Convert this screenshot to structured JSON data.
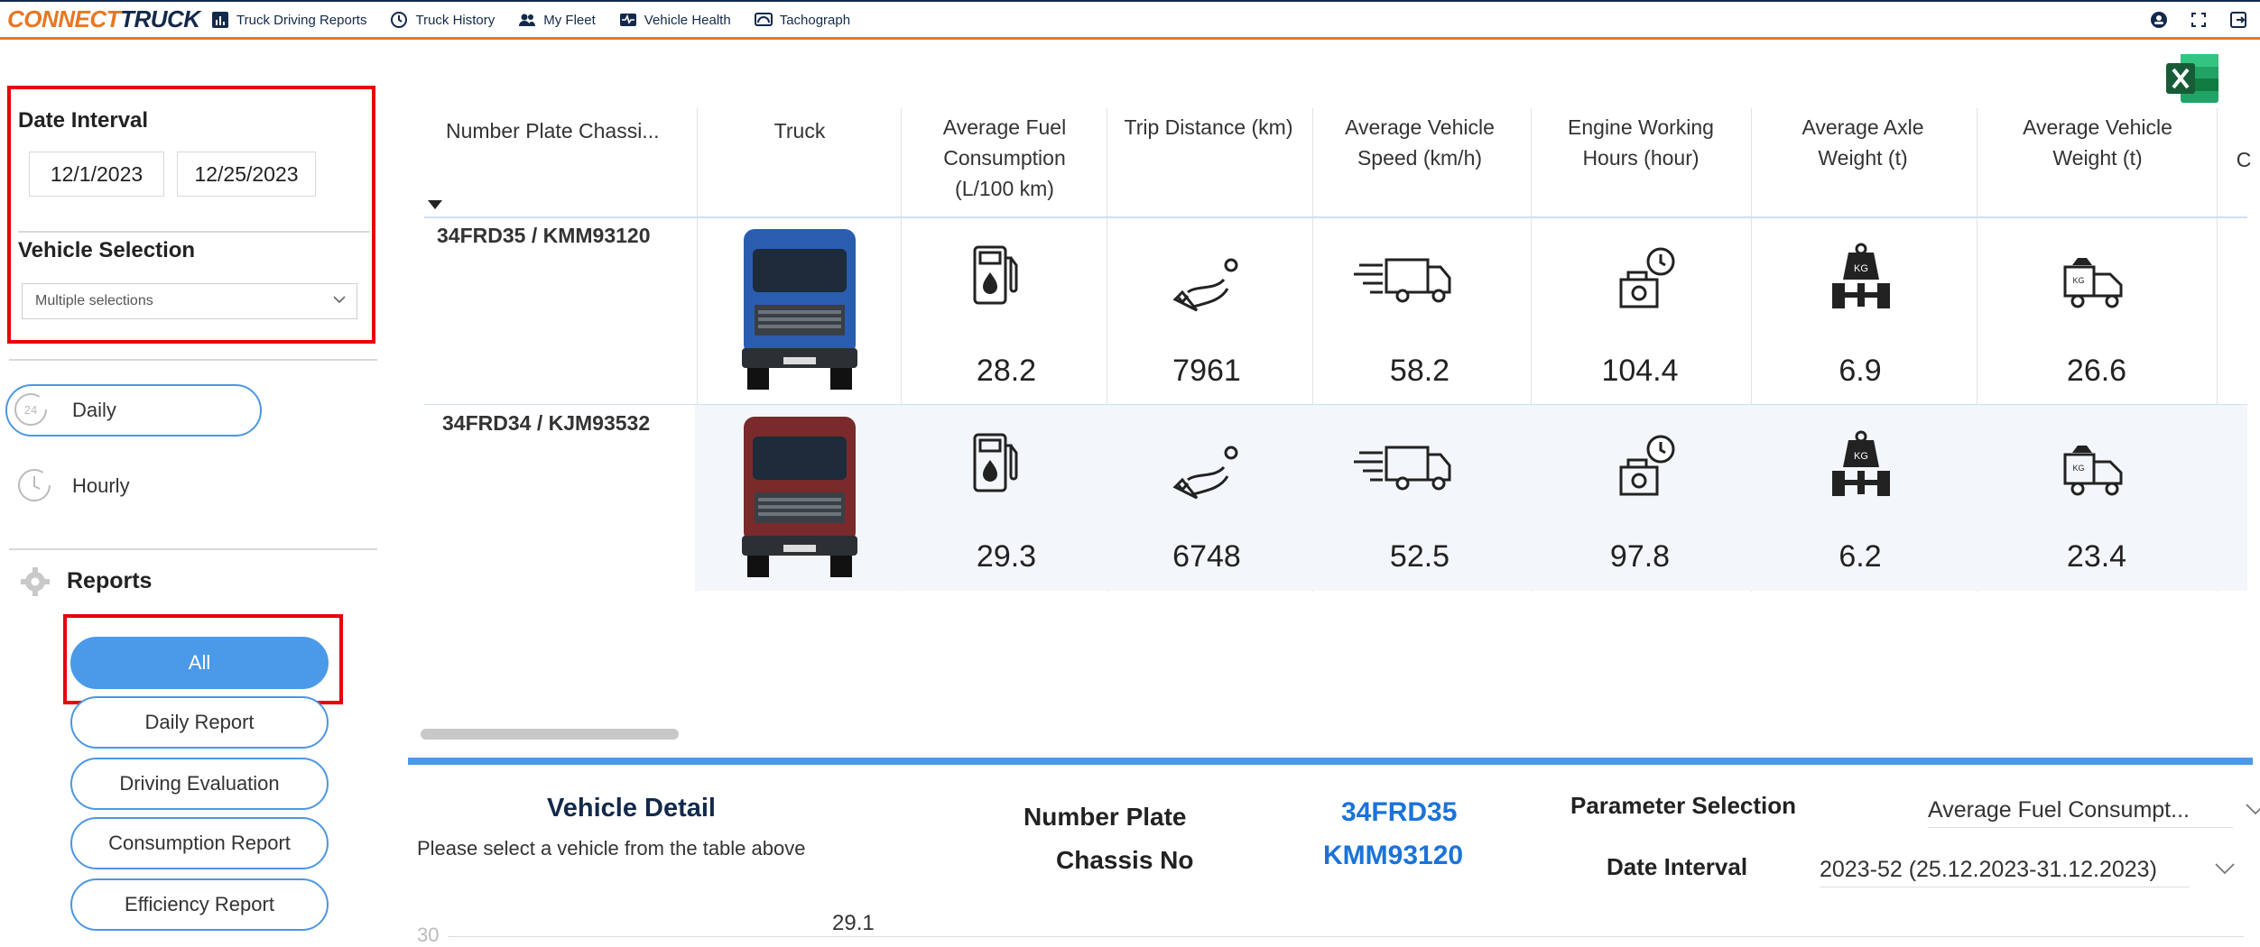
{
  "app": {
    "logo_part1": "CONNECT",
    "logo_part2": "RUCK",
    "nav": [
      {
        "label": "Truck Driving Reports",
        "icon": "report-icon"
      },
      {
        "label": "Truck History",
        "icon": "history-icon"
      },
      {
        "label": "My Fleet",
        "icon": "fleet-icon"
      },
      {
        "label": "Vehicle Health",
        "icon": "health-icon"
      },
      {
        "label": "Tachograph",
        "icon": "tachograph-icon"
      }
    ],
    "accent": "#e87722",
    "brand": "#13294b"
  },
  "sidebar": {
    "date_interval_label": "Date Interval",
    "start_date": "12/1/2023",
    "end_date": "12/25/2023",
    "vehicle_selection_label": "Vehicle Selection",
    "vehicle_selection_value": "Multiple selections",
    "frequency": [
      {
        "label": "Daily",
        "icon_text": "24"
      },
      {
        "label": "Hourly"
      }
    ],
    "reports_label": "Reports",
    "reports": [
      {
        "label": "All",
        "active": true
      },
      {
        "label": "Daily Report"
      },
      {
        "label": "Driving Evaluation"
      },
      {
        "label": "Consumption Report"
      },
      {
        "label": "Efficiency Report"
      }
    ]
  },
  "table": {
    "headers": {
      "plate": "Number Plate  Chassi...",
      "truck": "Truck",
      "fuel": [
        "Average Fuel",
        "Consumption",
        "(L/100 km)"
      ],
      "distance": [
        "Trip Distance (km)"
      ],
      "speed": [
        "Average Vehicle",
        "Speed (km/h)"
      ],
      "hours": [
        "Engine Working",
        "Hours (hour)"
      ],
      "axle": [
        "Average Axle",
        "Weight (t)"
      ],
      "weight": [
        "Average Vehicle",
        "Weight (t)"
      ],
      "next": "C"
    },
    "rows": [
      {
        "plate": "34FRD35 / KMM93120",
        "truck_color": "#2a5db0",
        "fuel": "28.2",
        "distance": "7961",
        "speed": "58.2",
        "hours": "104.4",
        "axle": "6.9",
        "weight": "26.6"
      },
      {
        "plate": "34FRD34 / KJM93532",
        "truck_color": "#7a2a2a",
        "fuel": "29.3",
        "distance": "6748",
        "speed": "52.5",
        "hours": "97.8",
        "axle": "6.2",
        "weight": "23.4"
      }
    ]
  },
  "detail": {
    "title": "Vehicle Detail",
    "subtitle": "Please select a vehicle from the table above",
    "number_plate_label": "Number Plate",
    "number_plate_value": "34FRD35",
    "chassis_label": "Chassis No",
    "chassis_value": "KMM93120",
    "parameter_label": "Parameter Selection",
    "parameter_value": "Average Fuel Consumpt...",
    "date_interval_label": "Date Interval",
    "date_interval_value": "2023-52 (25.12.2023-31.12.2023)",
    "chart_axis_tick": "30",
    "chart_data_label": "29.1"
  }
}
